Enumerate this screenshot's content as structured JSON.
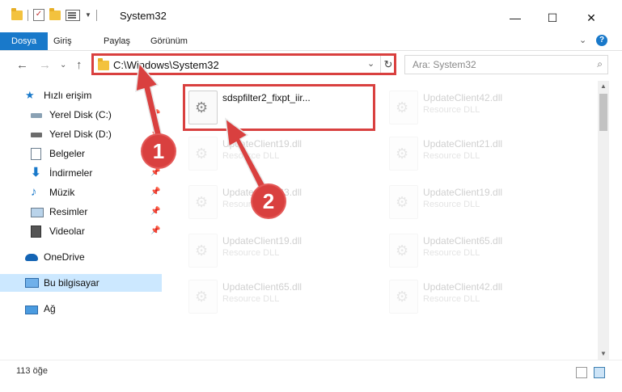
{
  "window": {
    "title": "System32",
    "minimize_glyph": "—",
    "maximize_glyph": "☐",
    "close_glyph": "✕"
  },
  "ribbon": {
    "tabs": [
      "Dosya",
      "Giriş",
      "Paylaş",
      "Görünüm"
    ],
    "expand_glyph": "⌄",
    "help_glyph": "?"
  },
  "address": {
    "path": "C:\\Windows\\System32",
    "back_glyph": "←",
    "forward_glyph": "→",
    "recent_glyph": "⌄",
    "up_glyph": "↑",
    "dropdown_glyph": "⌄",
    "refresh_glyph": "↻"
  },
  "search": {
    "placeholder": "Ara: System32",
    "icon_glyph": "⌕"
  },
  "sidebar": {
    "quick_access": "Hızlı erişim",
    "items": [
      {
        "label": "Yerel Disk (C:)",
        "icon": "drive-icon",
        "pinned": true
      },
      {
        "label": "Yerel Disk (D:)",
        "icon": "drive-icon",
        "pinned": true
      },
      {
        "label": "Belgeler",
        "icon": "documents-icon",
        "pinned": true
      },
      {
        "label": "İndirmeler",
        "icon": "downloads-icon",
        "pinned": true
      },
      {
        "label": "Müzik",
        "icon": "music-icon",
        "pinned": true
      },
      {
        "label": "Resimler",
        "icon": "pictures-icon",
        "pinned": true
      },
      {
        "label": "Videolar",
        "icon": "videos-icon",
        "pinned": true
      }
    ],
    "onedrive": "OneDrive",
    "this_pc": "Bu bilgisayar",
    "network": "Ağ",
    "pin_glyph": "📌"
  },
  "files": [
    {
      "name": "sdspfilter2_fixpt_iir...",
      "type": "",
      "faded": false
    },
    {
      "name": "UpdateClient42.dll",
      "type": "Resource DLL",
      "faded": true
    },
    {
      "name": "UpdateClient19.dll",
      "type": "Resource DLL",
      "faded": true
    },
    {
      "name": "UpdateClient21.dll",
      "type": "Resource DLL",
      "faded": true
    },
    {
      "name": "UpdateClient63.dll",
      "type": "Resource DLL",
      "faded": true
    },
    {
      "name": "UpdateClient19.dll",
      "type": "Resource DLL",
      "faded": true
    },
    {
      "name": "UpdateClient19.dll",
      "type": "Resource DLL",
      "faded": true
    },
    {
      "name": "UpdateClient65.dll",
      "type": "Resource DLL",
      "faded": true
    },
    {
      "name": "UpdateClient65.dll",
      "type": "Resource DLL",
      "faded": true
    },
    {
      "name": "UpdateClient42.dll",
      "type": "Resource DLL",
      "faded": true
    }
  ],
  "status": {
    "item_count": "113 öğe"
  },
  "annotations": {
    "step1": "1",
    "step2": "2",
    "color": "#d9403f"
  }
}
